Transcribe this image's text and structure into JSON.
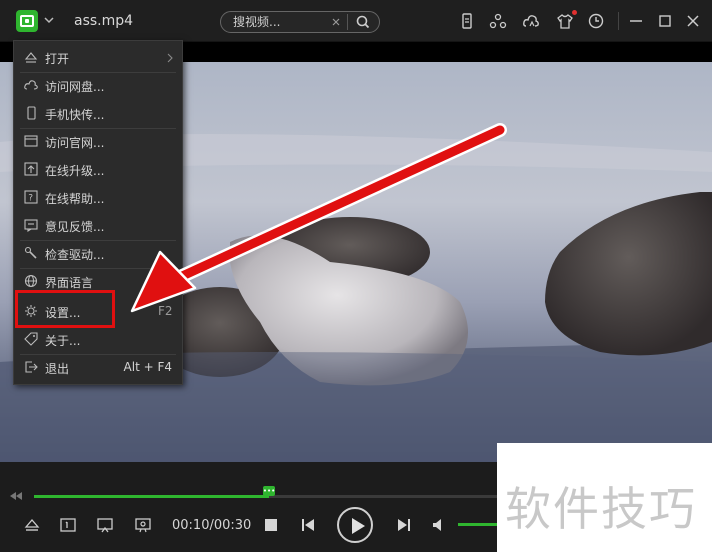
{
  "titlebar": {
    "filename": "ass.mp4",
    "search_placeholder": "搜视频..."
  },
  "titlebar_icons": [
    "phone-icon",
    "cloud-sync-icon",
    "cloud-icon",
    "tshirt-skin-icon",
    "clock-icon",
    "minimize-icon",
    "maximize-icon",
    "close-icon"
  ],
  "menu": {
    "items": [
      {
        "label": "打开",
        "icon": "eject-icon",
        "submenu": true
      },
      {
        "label": "访问网盘...",
        "icon": "cloud-icon"
      },
      {
        "label": "手机快传...",
        "icon": "phone-icon"
      },
      {
        "label": "访问官网...",
        "icon": "browser-icon"
      },
      {
        "label": "在线升级...",
        "icon": "upgrade-icon"
      },
      {
        "label": "在线帮助...",
        "icon": "help-icon"
      },
      {
        "label": "意见反馈...",
        "icon": "feedback-icon"
      },
      {
        "label": "检查驱动...",
        "icon": "driver-icon"
      },
      {
        "label": "界面语言",
        "icon": "globe-icon"
      },
      {
        "label": "设置...",
        "icon": "gear-icon"
      },
      {
        "label": "关于...",
        "icon": "tag-icon"
      },
      {
        "label": "退出",
        "icon": "exit-icon",
        "shortcut": "Alt + F4"
      }
    ],
    "hidden_shortcut": "F2"
  },
  "player": {
    "current_time": "00:10/00:30",
    "progress": 0.5,
    "knob_text": "•••",
    "volume_level": 1.0
  },
  "watermark": {
    "text": "软件技巧"
  },
  "colors": {
    "accent": "#2fb52f",
    "annotation_red": "#e01010"
  }
}
